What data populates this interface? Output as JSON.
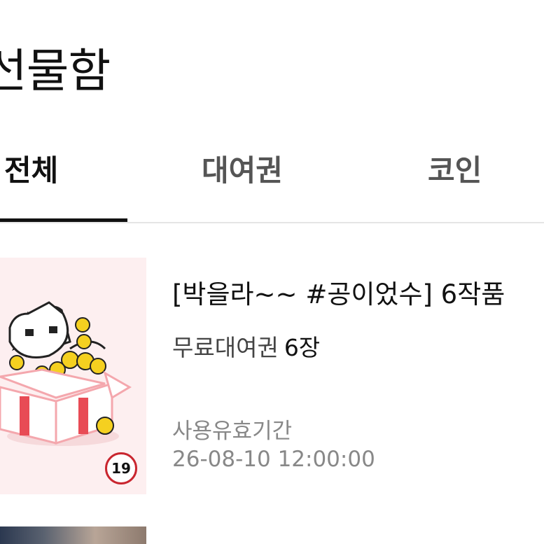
{
  "header": {
    "title": "선물함"
  },
  "tabs": [
    {
      "label": "전체",
      "active": true
    },
    {
      "label": "대여권",
      "active": false
    },
    {
      "label": "코인",
      "active": false
    }
  ],
  "gift_items": [
    {
      "title": "[박을라~~ #공이었수] 6작품",
      "description": "무료대여권",
      "count": "6장",
      "expiry_label": "사용유효기간",
      "expiry_date": "26-08-10 12:00:00",
      "age_rating": "19",
      "thumbnail_icon": "gift-box-cat-icon"
    }
  ],
  "colors": {
    "accent": "#111111",
    "thumbnail_bg": "#fdeff0",
    "age_badge": "#c9262f",
    "muted_text": "#888888"
  }
}
